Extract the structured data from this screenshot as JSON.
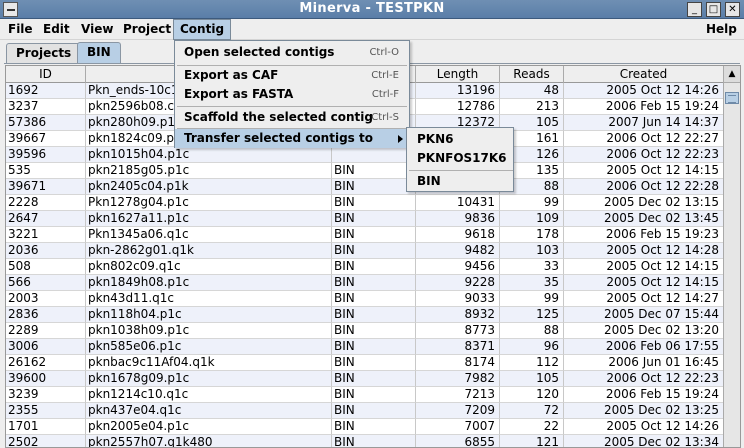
{
  "window": {
    "title": "Minerva - TESTPKN",
    "buttons": [
      "_",
      "□",
      "✕"
    ]
  },
  "menubar": [
    "File",
    "Edit",
    "View",
    "Project",
    "Contig",
    "Help"
  ],
  "tabs": [
    "Projects",
    "BIN"
  ],
  "table": {
    "columns": [
      "ID",
      "",
      "",
      "Length",
      "Reads",
      "Created"
    ],
    "rows": [
      [
        "1692",
        "Pkn_ends-10c1",
        "",
        "13196",
        "48",
        "2005 Oct 12 14:26"
      ],
      [
        "3237",
        "pkn2596b08.c",
        "",
        "12786",
        "213",
        "2006 Feb 15 19:24"
      ],
      [
        "57386",
        "pkn280h09.p1",
        "",
        "12372",
        "105",
        "2007 Jun 14 14:37"
      ],
      [
        "39667",
        "pkn1824c09.p",
        "",
        "",
        "161",
        "2006 Oct 12 22:27"
      ],
      [
        "39596",
        "pkn1015h04.p1c",
        "",
        "",
        "126",
        "2006 Oct 12 22:23"
      ],
      [
        "535",
        "pkn2185g05.p1c",
        "BIN",
        "",
        "135",
        "2005 Oct 12 14:15"
      ],
      [
        "39671",
        "pkn2405c04.p1k",
        "BIN",
        "",
        "88",
        "2006 Oct 12 22:28"
      ],
      [
        "2228",
        "Pkn1278g04.p1c",
        "BIN",
        "10431",
        "99",
        "2005 Dec 02 13:15"
      ],
      [
        "2647",
        "pkn1627a11.p1c",
        "BIN",
        "9836",
        "109",
        "2005 Dec 02 13:45"
      ],
      [
        "3221",
        "Pkn1345a06.q1c",
        "BIN",
        "9618",
        "178",
        "2006 Feb 15 19:23"
      ],
      [
        "2036",
        "pkn-2862g01.q1k",
        "BIN",
        "9482",
        "103",
        "2005 Oct 12 14:28"
      ],
      [
        "508",
        "pkn802c09.q1c",
        "BIN",
        "9456",
        "33",
        "2005 Oct 12 14:15"
      ],
      [
        "566",
        "pkn1849h08.p1c",
        "BIN",
        "9228",
        "35",
        "2005 Oct 12 14:15"
      ],
      [
        "2003",
        "pkn43d11.q1c",
        "BIN",
        "9033",
        "99",
        "2005 Oct 12 14:27"
      ],
      [
        "2836",
        "pkn118h04.p1c",
        "BIN",
        "8932",
        "125",
        "2005 Dec 07 15:44"
      ],
      [
        "2289",
        "pkn1038h09.p1c",
        "BIN",
        "8773",
        "88",
        "2005 Dec 02 13:20"
      ],
      [
        "3006",
        "pkn585e06.p1c",
        "BIN",
        "8371",
        "96",
        "2006 Feb 06 17:55"
      ],
      [
        "26162",
        "pknbac9c11Af04.q1k",
        "BIN",
        "8174",
        "112",
        "2006 Jun 01 16:45"
      ],
      [
        "39600",
        "pkn1678g09.p1c",
        "BIN",
        "7982",
        "105",
        "2006 Oct 12 22:23"
      ],
      [
        "3239",
        "pkn1214c10.q1c",
        "BIN",
        "7213",
        "120",
        "2006 Feb 15 19:24"
      ],
      [
        "2355",
        "pkn437e04.q1c",
        "BIN",
        "7209",
        "72",
        "2005 Dec 02 13:25"
      ],
      [
        "1701",
        "pkn2005e04.p1c",
        "BIN",
        "7007",
        "22",
        "2005 Oct 12 14:26"
      ],
      [
        "2502",
        "pkn2557h07.q1k480",
        "BIN",
        "6855",
        "121",
        "2005 Dec 02 13:34"
      ]
    ]
  },
  "contig_menu": {
    "title": "Contig",
    "items": [
      {
        "label": "Open selected contigs",
        "shortcut": "Ctrl-O"
      },
      {
        "label": "Export as CAF",
        "shortcut": "Ctrl-E"
      },
      {
        "label": "Export as FASTA",
        "shortcut": "Ctrl-F"
      },
      {
        "label": "Scaffold the selected contig",
        "shortcut": "Ctrl-S"
      },
      {
        "label": "Transfer selected contigs to",
        "shortcut": ""
      }
    ]
  },
  "transfer_submenu": [
    "PKN6",
    "PKNFOS17K6",
    "BIN"
  ],
  "colors": {
    "titlebar": "#5a7ea8",
    "highlight": "#b8cfe5",
    "row_alt": "#eef1fa"
  }
}
